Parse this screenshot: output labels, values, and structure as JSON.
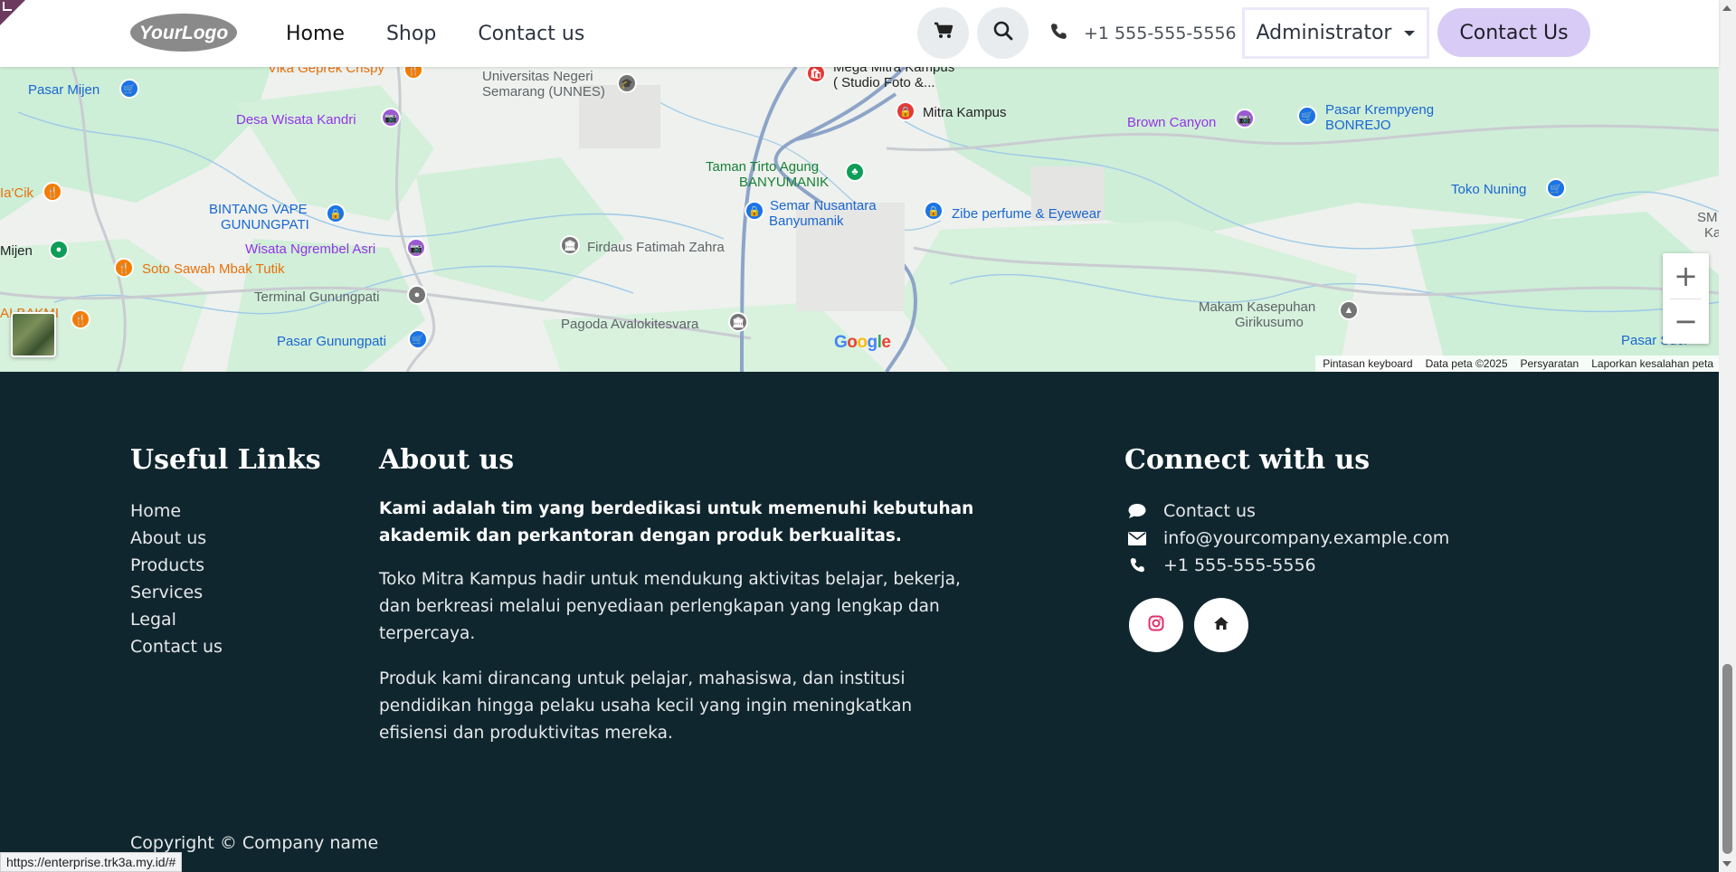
{
  "header": {
    "logo_text": "YourLogo",
    "nav": [
      {
        "label": "Home"
      },
      {
        "label": "Shop"
      },
      {
        "label": "Contact us"
      }
    ],
    "phone": "+1 555-555-5556",
    "admin_label": "Administrator",
    "contact_button": "Contact Us"
  },
  "map": {
    "labels": [
      "Pasar Mijen",
      "Vika Geprek Crispy",
      "Universitas Negeri",
      "Semarang (UNNES)",
      "Mega Mitra Kampus",
      "( Studio Foto &...",
      "Mitra Kampus",
      "Brown Canyon",
      "Pasar Krempyeng",
      "BONREJO",
      "Desa Wisata Kandri",
      "Taman Tirto Agung",
      "BANYUMANIK",
      "Ia'Cik",
      "BINTANG VAPE",
      "GUNUNGPATI",
      "Semar Nusantara",
      "Banyumanik",
      "Zibe perfume & Eyewear",
      "Toko Nuning",
      "Mijen",
      "Wisata Ngrembel Asri",
      "Firdaus Fatimah Zahra",
      "Soto Sawah Mbak Tutik",
      "Terminal Gunungpati",
      "Makam Kasepuhan",
      "Girikusumo",
      "AI BAKMI",
      "Pagoda Avalokitesvara",
      "Pasar Gunungpati",
      "Pasar Suci",
      "SM",
      "Ka"
    ],
    "zoom_in": "+",
    "zoom_out": "−",
    "google": "Google",
    "footer_links": [
      "Pintasan keyboard",
      "Data peta ©2025",
      "Persyaratan",
      "Laporkan kesalahan peta"
    ]
  },
  "footer": {
    "useful_links_title": "Useful Links",
    "useful_links": [
      "Home",
      "About us",
      "Products",
      "Services",
      "Legal",
      "Contact us"
    ],
    "about_title": "About us",
    "about_bold": "Kami adalah tim yang berdedikasi untuk memenuhi kebutuhan akademik dan perkantoran dengan produk berkualitas.",
    "about_p1": "Toko Mitra Kampus hadir untuk mendukung aktivitas belajar, bekerja, dan berkreasi melalui penyediaan perlengkapan yang lengkap dan terpercaya.",
    "about_p2": "Produk kami dirancang untuk pelajar, mahasiswa, dan institusi pendidikan hingga pelaku usaha kecil yang ingin meningkatkan efisiensi dan produktivitas mereka.",
    "connect_title": "Connect with us",
    "connect": [
      {
        "icon": "comment-icon",
        "label": "Contact us"
      },
      {
        "icon": "envelope-icon",
        "label": "info@yourcompany.example.com"
      },
      {
        "icon": "phone-icon",
        "label": "+1 555-555-5556"
      }
    ],
    "social": [
      {
        "icon": "instagram-icon",
        "color": "#e1306c"
      },
      {
        "icon": "home-icon",
        "color": "#222222"
      }
    ],
    "copyright": "Copyright © Company name"
  },
  "status_url": "https://enterprise.trk3a.my.id/#",
  "colors": {
    "footer_bg": "#10262f",
    "accent": "#d8ccf6",
    "corner": "#6b3a5e"
  }
}
